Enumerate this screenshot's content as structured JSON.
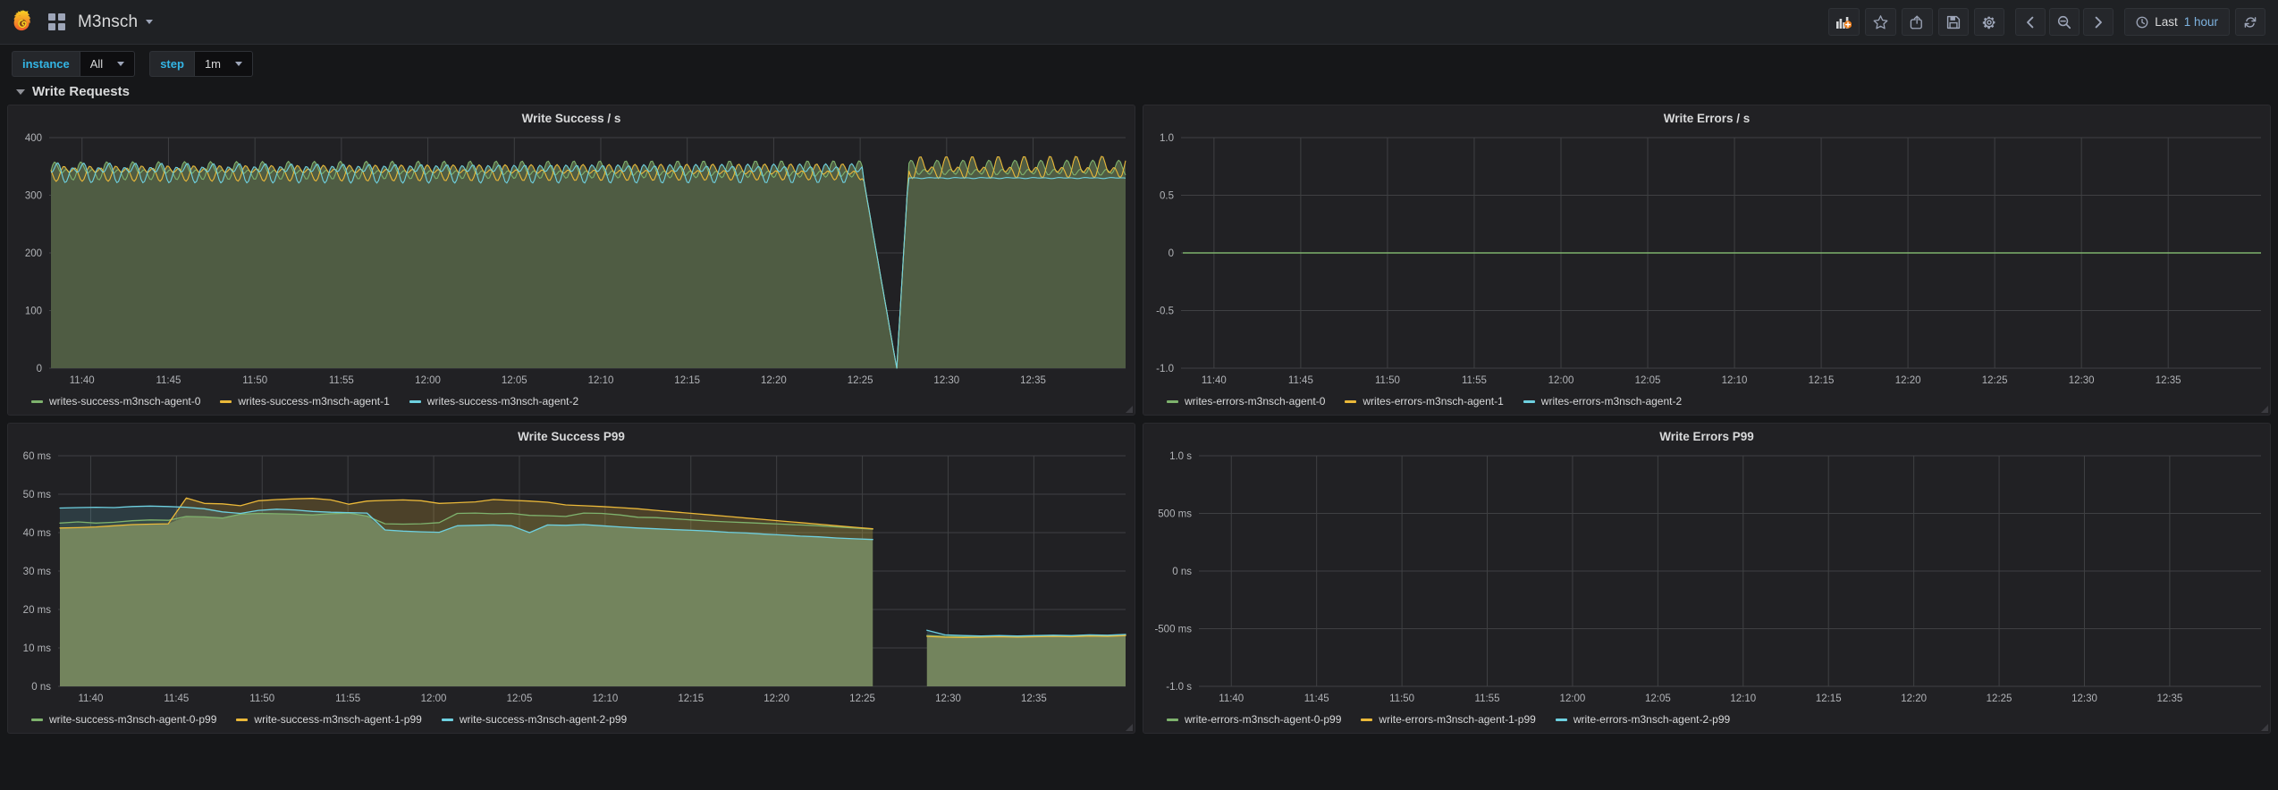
{
  "navbar": {
    "dashboard_title": "M3nsch",
    "logo_icon": "grafana-logo-icon",
    "grid_icon": "dashboard-grid-icon",
    "caret_icon": "chevron-down-icon",
    "buttons": [
      {
        "name": "add-panel-button",
        "icon": "add-panel-icon",
        "label": ""
      },
      {
        "name": "mark-favorite-button",
        "icon": "star-icon",
        "label": ""
      },
      {
        "name": "share-dashboard-button",
        "icon": "share-icon",
        "label": ""
      },
      {
        "name": "save-dashboard-button",
        "icon": "save-icon",
        "label": ""
      },
      {
        "name": "dashboard-settings-button",
        "icon": "gear-icon",
        "label": ""
      }
    ],
    "time_nav": [
      {
        "name": "time-shift-back-button",
        "icon": "chevron-left-icon"
      },
      {
        "name": "zoom-out-button",
        "icon": "search-minus-icon"
      },
      {
        "name": "time-shift-forward-button",
        "icon": "chevron-right-icon"
      }
    ],
    "time_picker": {
      "icon": "clock-icon",
      "prefix": "Last",
      "value": "1 hour"
    },
    "refresh": {
      "name": "refresh-button",
      "icon": "refresh-icon"
    }
  },
  "variables": [
    {
      "label": "instance",
      "value": "All",
      "name": "instance"
    },
    {
      "label": "step",
      "value": "1m",
      "name": "step"
    }
  ],
  "row": {
    "title": "Write Requests",
    "collapse_icon": "chevron-down-icon"
  },
  "colors": {
    "series_green": "#7eb26d",
    "series_yellow": "#eab839",
    "series_cyan": "#6ed0e0",
    "panel_bg": "#212124",
    "page_bg": "#161719",
    "grid_line": "#3f4043",
    "accent_cyan": "#33b5e5",
    "text": "#d8d9da"
  },
  "chart_data": [
    {
      "id": "write-success-per-s",
      "type": "area",
      "title": "Write Success / s",
      "xlabel": "",
      "ylabel": "",
      "ylim": [
        0,
        400
      ],
      "yticks": [
        0,
        100,
        200,
        300,
        400
      ],
      "ytick_labels": [
        "0",
        "100",
        "200",
        "300",
        "400"
      ],
      "xticks": [
        "11:40",
        "11:45",
        "11:50",
        "11:55",
        "12:00",
        "12:05",
        "12:10",
        "12:15",
        "12:20",
        "12:25",
        "12:30",
        "12:35"
      ],
      "grid": true,
      "legend_position": "bottom",
      "fill": true,
      "description": "High-frequency sawtooth oscillation near 320-360 with a sharp dropout to 0 just before 12:25, then recovery.",
      "baseline": 340,
      "oscillation_amplitude": 22,
      "dropout": {
        "start": "12:22",
        "bottom": "12:24",
        "end": "12:24.5",
        "value": 0
      },
      "series": [
        {
          "name": "writes-success-m3nsch-agent-0",
          "color": "#7eb26d",
          "mean_before": 342,
          "mean_after": 345
        },
        {
          "name": "writes-success-m3nsch-agent-1",
          "color": "#eab839",
          "mean_before": 340,
          "mean_after": 347
        },
        {
          "name": "writes-success-m3nsch-agent-2",
          "color": "#6ed0e0",
          "mean_before": 341,
          "mean_after": 330
        }
      ]
    },
    {
      "id": "write-errors-per-s",
      "type": "line",
      "title": "Write Errors / s",
      "xlabel": "",
      "ylabel": "",
      "ylim": [
        -1.0,
        1.0
      ],
      "yticks": [
        -1.0,
        -0.5,
        0,
        0.5,
        1.0
      ],
      "ytick_labels": [
        "-1.0",
        "-0.5",
        "0",
        "0.5",
        "1.0"
      ],
      "xticks": [
        "11:40",
        "11:45",
        "11:50",
        "11:55",
        "12:00",
        "12:05",
        "12:10",
        "12:15",
        "12:20",
        "12:25",
        "12:30",
        "12:35"
      ],
      "grid": true,
      "legend_position": "bottom",
      "fill": false,
      "description": "Flat zero line across the entire window; no write errors recorded.",
      "series": [
        {
          "name": "writes-errors-m3nsch-agent-0",
          "color": "#7eb26d",
          "constant": 0
        },
        {
          "name": "writes-errors-m3nsch-agent-1",
          "color": "#eab839",
          "constant": 0
        },
        {
          "name": "writes-errors-m3nsch-agent-2",
          "color": "#6ed0e0",
          "constant": 0
        }
      ]
    },
    {
      "id": "write-success-p99",
      "type": "area",
      "title": "Write Success P99",
      "xlabel": "",
      "ylabel": "",
      "ylim": [
        0,
        60
      ],
      "yticks": [
        0,
        10,
        20,
        30,
        40,
        50,
        60
      ],
      "ytick_labels": [
        "0 ns",
        "10 ms",
        "20 ms",
        "30 ms",
        "40 ms",
        "50 ms",
        "60 ms"
      ],
      "xticks": [
        "11:40",
        "11:45",
        "11:50",
        "11:55",
        "12:00",
        "12:05",
        "12:10",
        "12:15",
        "12:20",
        "12:25",
        "12:30",
        "12:35"
      ],
      "grid": true,
      "legend_position": "bottom",
      "fill": true,
      "unit": "ms",
      "description": "Three agents hover in the 38-49 ms band with a yellow spike to 49 ms near 12:03; data gap 12:22-12:24 then all series settle flat near 13 ms.",
      "gap": {
        "start": "12:22",
        "end": "12:24"
      },
      "series": [
        {
          "name": "write-success-m3nsch-agent-0-p99",
          "color": "#7eb26d",
          "values": [
            42.5,
            42.8,
            42.5,
            42.7,
            43.1,
            43.3,
            43.2,
            44.2,
            44.1,
            43.8,
            44.8,
            45.0,
            44.9,
            44.8,
            44.6,
            44.9,
            45.1,
            44.3,
            42.3,
            42.2,
            42.3,
            42.6,
            45.0,
            45.1,
            44.9,
            45.0,
            44.5,
            44.4,
            44.2,
            45.1,
            45.0,
            44.6,
            44.0,
            43.9,
            43.6,
            43.3,
            43.0,
            42.8,
            42.6,
            42.4,
            42.2,
            42.0,
            41.8,
            41.5,
            41.2,
            40.9,
            null,
            null,
            13.2,
            13.0,
            12.9,
            13.0,
            13.1,
            13.0,
            13.1,
            13.2,
            13.1,
            13.3,
            13.2,
            13.4
          ]
        },
        {
          "name": "write-success-m3nsch-agent-1-p99",
          "color": "#eab839",
          "values": [
            41.2,
            41.3,
            41.5,
            41.8,
            42.1,
            42.2,
            42.3,
            49.0,
            47.6,
            47.5,
            47.0,
            48.3,
            48.6,
            48.8,
            48.9,
            48.5,
            47.4,
            48.2,
            48.4,
            48.5,
            48.3,
            47.6,
            47.8,
            48.0,
            48.6,
            48.4,
            48.2,
            47.9,
            47.2,
            47.0,
            46.8,
            46.5,
            46.2,
            45.8,
            45.4,
            45.0,
            44.6,
            44.2,
            43.8,
            43.4,
            43.0,
            42.6,
            42.2,
            41.8,
            41.4,
            41.0,
            null,
            null,
            13.0,
            12.8,
            12.7,
            12.8,
            12.9,
            12.8,
            12.9,
            13.0,
            12.9,
            13.1,
            13.0,
            13.2
          ]
        },
        {
          "name": "write-success-m3nsch-agent-2-p99",
          "color": "#6ed0e0",
          "values": [
            46.4,
            46.5,
            46.6,
            46.5,
            46.8,
            46.9,
            46.8,
            46.6,
            46.2,
            45.4,
            45.0,
            45.8,
            46.1,
            45.9,
            45.5,
            45.3,
            45.2,
            45.1,
            40.7,
            40.4,
            40.2,
            40.1,
            41.8,
            41.9,
            42.0,
            41.8,
            40.0,
            42.0,
            41.9,
            42.1,
            41.8,
            41.5,
            41.2,
            41.0,
            40.8,
            40.6,
            40.4,
            40.1,
            39.9,
            39.6,
            39.4,
            39.1,
            38.9,
            38.6,
            38.4,
            38.2,
            null,
            null,
            14.6,
            13.4,
            13.2,
            13.1,
            13.2,
            13.1,
            13.2,
            13.3,
            13.2,
            13.4,
            13.3,
            13.5
          ]
        }
      ]
    },
    {
      "id": "write-errors-p99",
      "type": "line",
      "title": "Write Errors P99",
      "xlabel": "",
      "ylabel": "",
      "ylim": [
        -1.0,
        1.0
      ],
      "yticks": [
        -1.0,
        -0.5,
        0,
        0.5,
        1.0
      ],
      "ytick_labels": [
        "-1.0 s",
        "-500 ms",
        "0 ns",
        "500 ms",
        "1.0 s"
      ],
      "xticks": [
        "11:40",
        "11:45",
        "11:50",
        "11:55",
        "12:00",
        "12:05",
        "12:10",
        "12:15",
        "12:20",
        "12:25",
        "12:30",
        "12:35"
      ],
      "grid": true,
      "legend_position": "bottom",
      "fill": false,
      "description": "Empty panel — no data points plotted for any agent.",
      "series": [
        {
          "name": "write-errors-m3nsch-agent-0-p99",
          "color": "#7eb26d",
          "values": []
        },
        {
          "name": "write-errors-m3nsch-agent-1-p99",
          "color": "#eab839",
          "values": []
        },
        {
          "name": "write-errors-m3nsch-agent-2-p99",
          "color": "#6ed0e0",
          "values": []
        }
      ]
    }
  ]
}
